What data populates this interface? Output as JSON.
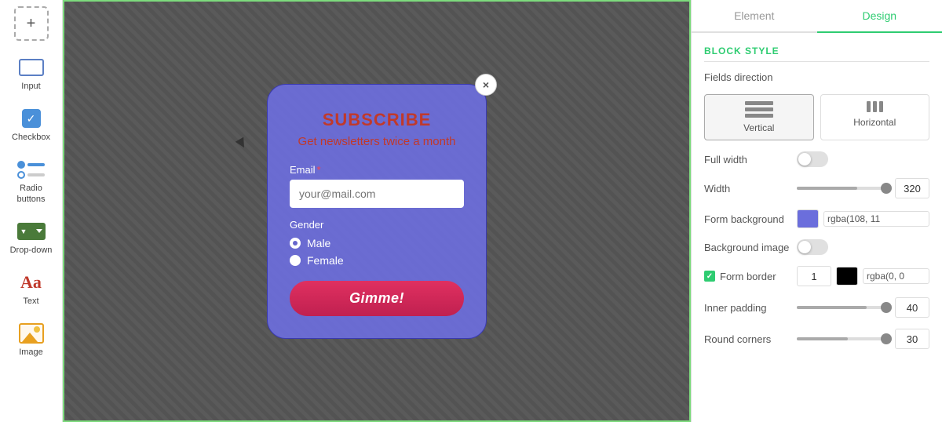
{
  "sidebar": {
    "add_label": "+",
    "items": [
      {
        "id": "input",
        "label": "Input",
        "icon": "input-icon"
      },
      {
        "id": "checkbox",
        "label": "Checkbox",
        "icon": "checkbox-icon"
      },
      {
        "id": "radio-buttons",
        "label": "Radio buttons",
        "icon": "radio-icon"
      },
      {
        "id": "drop-down",
        "label": "Drop-down",
        "icon": "dropdown-icon"
      },
      {
        "id": "text",
        "label": "Text",
        "icon": "text-icon"
      },
      {
        "id": "image",
        "label": "Image",
        "icon": "image-icon"
      }
    ]
  },
  "form": {
    "title": "SUBSCRIBE",
    "subtitle": "Get newsletters twice a month",
    "email_label": "Email",
    "email_placeholder": "your@mail.com",
    "gender_label": "Gender",
    "gender_options": [
      "Male",
      "Female"
    ],
    "submit_label": "Gimme!",
    "close_label": "×"
  },
  "panel": {
    "tab_element": "Element",
    "tab_design": "Design",
    "section_title": "BLOCK STYLE",
    "fields_direction_label": "Fields direction",
    "direction_vertical": "Vertical",
    "direction_horizontal": "Horizontal",
    "full_width_label": "Full width",
    "width_label": "Width",
    "width_value": "320",
    "form_background_label": "Form background",
    "form_background_color": "#6b6edc",
    "form_background_value": "rgba(108, 11",
    "background_image_label": "Background image",
    "form_border_label": "Form border",
    "form_border_width": "1",
    "form_border_color": "#000000",
    "form_border_color_value": "rgba(0, 0",
    "inner_padding_label": "Inner padding",
    "inner_padding_value": "40",
    "round_corners_label": "Round corners",
    "round_corners_value": "30"
  }
}
